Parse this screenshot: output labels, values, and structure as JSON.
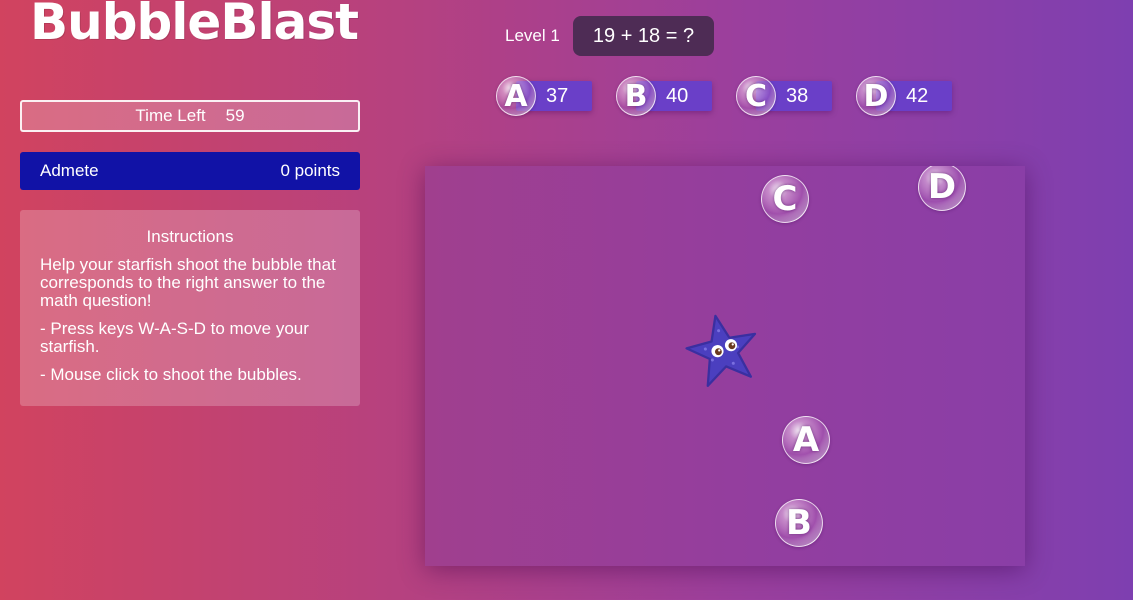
{
  "logo": "BubbleBlast",
  "timer": {
    "label": "Time Left",
    "value": "59"
  },
  "player": {
    "name": "Admete",
    "score": "0 points"
  },
  "instructions": {
    "title": "Instructions",
    "lines": [
      "Help your starfish shoot the bubble that corresponds to the right answer to the math question!",
      "- Press keys W-A-S-D to move your starfish.",
      "- Mouse click to shoot the bubbles."
    ]
  },
  "level": "Level 1",
  "question": "19 + 18 = ?",
  "answers": [
    {
      "letter": "A",
      "value": "37"
    },
    {
      "letter": "B",
      "value": "40"
    },
    {
      "letter": "C",
      "value": "38"
    },
    {
      "letter": "D",
      "value": "42"
    }
  ],
  "arena_bubbles": [
    {
      "letter": "C"
    },
    {
      "letter": "D"
    },
    {
      "letter": "A"
    },
    {
      "letter": "B"
    }
  ],
  "colors": {
    "player_bar": "#1112a6",
    "answer_pill": "#6a3fc8",
    "question_box": "#4e2c55",
    "starfish": "#4b3fbf"
  },
  "icons": {
    "player_character": "starfish-icon"
  }
}
